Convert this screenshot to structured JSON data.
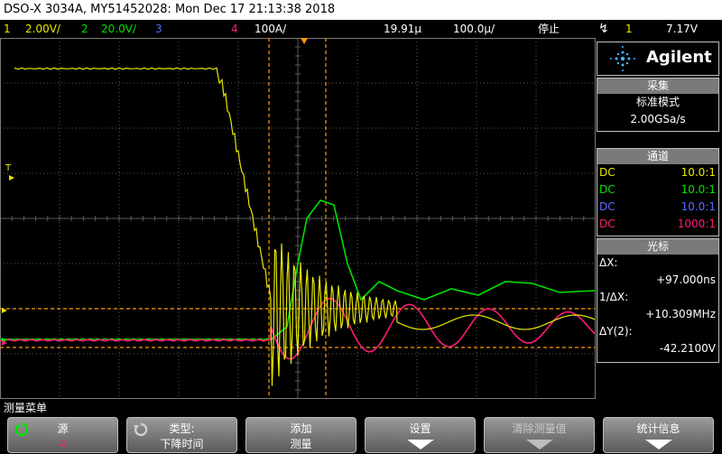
{
  "title": "DSO-X 3034A, MY51452028: Mon Dec 17 21:13:38 2018",
  "status": {
    "ch1": "1",
    "ch1_scale": "2.00V/",
    "ch2": "2",
    "ch2_scale": "20.0V/",
    "ch3": "3",
    "ch4": "4",
    "ch4_scale": "100A/",
    "time_offset": "19.91µ",
    "time_scale": "100.0µ/",
    "run_state": "停止",
    "trigger_icon": "↯",
    "trigger_src": "1",
    "trigger_level": "7.17V"
  },
  "brand": "Agilent",
  "acq": {
    "header": "采集",
    "mode": "标准模式",
    "rate": "2.00GSa/s"
  },
  "channels": {
    "header": "通道",
    "rows": [
      {
        "coupling": "DC",
        "probe": "10.0:1",
        "color": "#e8e800"
      },
      {
        "coupling": "DC",
        "probe": "10.0:1",
        "color": "#00e000"
      },
      {
        "coupling": "DC",
        "probe": "10.0:1",
        "color": "#5a6aff"
      },
      {
        "coupling": "DC",
        "probe": "1000:1",
        "color": "#ff1a7a"
      }
    ]
  },
  "cursors": {
    "header": "光标",
    "dx_label": "ΔX:",
    "dx_value": "+97.000ns",
    "inv_label": "1/ΔX:",
    "inv_value": "+10.309MHz",
    "dy_label": "ΔY(2):",
    "dy_value": "-42.2100V"
  },
  "menu_title": "测量菜单",
  "softkeys": {
    "source_label": "源",
    "source_value": "4",
    "type_label": "类型:",
    "type_value": "下降时间",
    "add_label": "添加",
    "add_value": "测量",
    "settings_label": "设置",
    "clear_label": "清除测量值",
    "stats_label": "统计信息"
  },
  "markers": {
    "trigger_t": "T"
  },
  "colors": {
    "ch1": "#e8e800",
    "ch2": "#00e000",
    "ch3": "#5a6aff",
    "ch4": "#ff1a7a",
    "cursor": "#ff9900",
    "grid": "#5a5a5a"
  }
}
